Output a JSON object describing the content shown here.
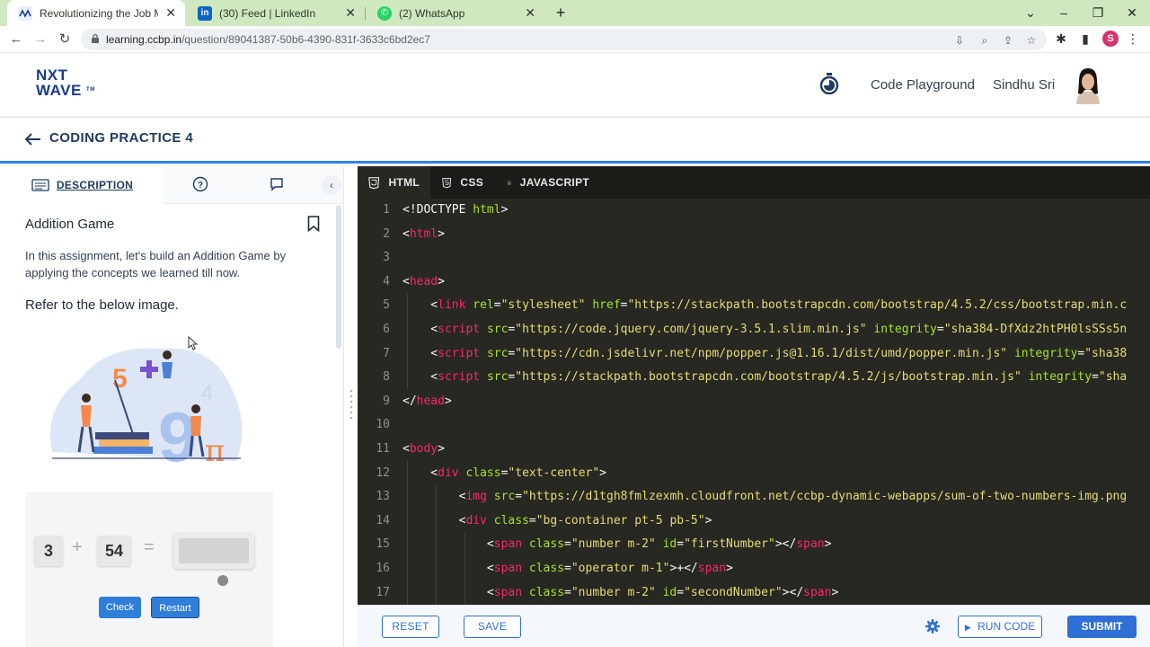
{
  "browser": {
    "tabs": [
      {
        "title": "Revolutionizing the Job Market |",
        "active": true
      },
      {
        "title": "(30) Feed | LinkedIn",
        "active": false
      },
      {
        "title": "(2) WhatsApp",
        "active": false
      }
    ],
    "url_host": "learning.ccbp.in",
    "url_path": "/question/89041387-50b6-4390-831f-3633c6bd2ec7",
    "profile_initial": "S"
  },
  "header": {
    "logo_line1": "NXT",
    "logo_line2": "WAVE",
    "logo_tm": "TM",
    "playground_label": "Code Playground",
    "user_name": "Sindhu Sri"
  },
  "practice": {
    "title": "CODING PRACTICE 4"
  },
  "left_panel": {
    "tab_description": "DESCRIPTION",
    "question_title": "Addition Game",
    "question_desc": "In this assignment, let's build an Addition Game by applying the concepts we learned till now.",
    "refer_text": "Refer to the below image.",
    "game": {
      "first_number": "3",
      "operator": "+",
      "second_number": "54",
      "equals": "=",
      "check_label": "Check",
      "restart_label": "Restart"
    },
    "illustration_digits": [
      "5",
      "9",
      "4",
      "π"
    ]
  },
  "editor": {
    "tabs": [
      "HTML",
      "CSS",
      "JAVASCRIPT"
    ],
    "lines": [
      {
        "n": "1",
        "parts": [
          [
            "txt",
            "<!DOCTYPE "
          ],
          [
            "attr",
            "html"
          ],
          [
            "txt",
            ">"
          ]
        ]
      },
      {
        "n": "2",
        "parts": [
          [
            "txt",
            "<"
          ],
          [
            "tag",
            "html"
          ],
          [
            "txt",
            ">"
          ]
        ]
      },
      {
        "n": "3",
        "parts": []
      },
      {
        "n": "4",
        "parts": [
          [
            "txt",
            "<"
          ],
          [
            "tag",
            "head"
          ],
          [
            "txt",
            ">"
          ]
        ]
      },
      {
        "n": "5",
        "parts": [
          [
            "txt",
            "    <"
          ],
          [
            "tag",
            "link"
          ],
          [
            "txt",
            " "
          ],
          [
            "attr",
            "rel"
          ],
          [
            "txt",
            "="
          ],
          [
            "str",
            "\"stylesheet\""
          ],
          [
            "txt",
            " "
          ],
          [
            "attr",
            "href"
          ],
          [
            "txt",
            "="
          ],
          [
            "str",
            "\"https://stackpath.bootstrapcdn.com/bootstrap/4.5.2/css/bootstrap.min.c"
          ]
        ]
      },
      {
        "n": "6",
        "parts": [
          [
            "txt",
            "    <"
          ],
          [
            "tag",
            "script"
          ],
          [
            "txt",
            " "
          ],
          [
            "attr",
            "src"
          ],
          [
            "txt",
            "="
          ],
          [
            "str",
            "\"https://code.jquery.com/jquery-3.5.1.slim.min.js\""
          ],
          [
            "txt",
            " "
          ],
          [
            "attr",
            "integrity"
          ],
          [
            "txt",
            "="
          ],
          [
            "str",
            "\"sha384-DfXdz2htPH0lsSSs5n"
          ]
        ]
      },
      {
        "n": "7",
        "parts": [
          [
            "txt",
            "    <"
          ],
          [
            "tag",
            "script"
          ],
          [
            "txt",
            " "
          ],
          [
            "attr",
            "src"
          ],
          [
            "txt",
            "="
          ],
          [
            "str",
            "\"https://cdn.jsdelivr.net/npm/popper.js@1.16.1/dist/umd/popper.min.js\""
          ],
          [
            "txt",
            " "
          ],
          [
            "attr",
            "integrity"
          ],
          [
            "txt",
            "="
          ],
          [
            "str",
            "\"sha38"
          ]
        ]
      },
      {
        "n": "8",
        "parts": [
          [
            "txt",
            "    <"
          ],
          [
            "tag",
            "script"
          ],
          [
            "txt",
            " "
          ],
          [
            "attr",
            "src"
          ],
          [
            "txt",
            "="
          ],
          [
            "str",
            "\"https://stackpath.bootstrapcdn.com/bootstrap/4.5.2/js/bootstrap.min.js\""
          ],
          [
            "txt",
            " "
          ],
          [
            "attr",
            "integrity"
          ],
          [
            "txt",
            "="
          ],
          [
            "str",
            "\"sha"
          ]
        ]
      },
      {
        "n": "9",
        "parts": [
          [
            "txt",
            "</"
          ],
          [
            "tag",
            "head"
          ],
          [
            "txt",
            ">"
          ]
        ]
      },
      {
        "n": "10",
        "parts": []
      },
      {
        "n": "11",
        "parts": [
          [
            "txt",
            "<"
          ],
          [
            "tag",
            "body"
          ],
          [
            "txt",
            ">"
          ]
        ]
      },
      {
        "n": "12",
        "parts": [
          [
            "txt",
            "    <"
          ],
          [
            "tag",
            "div"
          ],
          [
            "txt",
            " "
          ],
          [
            "attr",
            "class"
          ],
          [
            "txt",
            "="
          ],
          [
            "str",
            "\"text-center\""
          ],
          [
            "txt",
            ">"
          ]
        ]
      },
      {
        "n": "13",
        "parts": [
          [
            "txt",
            "        <"
          ],
          [
            "tag",
            "img"
          ],
          [
            "txt",
            " "
          ],
          [
            "attr",
            "src"
          ],
          [
            "txt",
            "="
          ],
          [
            "str",
            "\"https://d1tgh8fmlzexmh.cloudfront.net/ccbp-dynamic-webapps/sum-of-two-numbers-img.png"
          ]
        ]
      },
      {
        "n": "14",
        "parts": [
          [
            "txt",
            "        <"
          ],
          [
            "tag",
            "div"
          ],
          [
            "txt",
            " "
          ],
          [
            "attr",
            "class"
          ],
          [
            "txt",
            "="
          ],
          [
            "str",
            "\"bg-container pt-5 pb-5\""
          ],
          [
            "txt",
            ">"
          ]
        ]
      },
      {
        "n": "15",
        "parts": [
          [
            "txt",
            "            <"
          ],
          [
            "tag",
            "span"
          ],
          [
            "txt",
            " "
          ],
          [
            "attr",
            "class"
          ],
          [
            "txt",
            "="
          ],
          [
            "str",
            "\"number m-2\""
          ],
          [
            "txt",
            " "
          ],
          [
            "attr",
            "id"
          ],
          [
            "txt",
            "="
          ],
          [
            "str",
            "\"firstNumber\""
          ],
          [
            "txt",
            "></"
          ],
          [
            "tag",
            "span"
          ],
          [
            "txt",
            ">"
          ]
        ]
      },
      {
        "n": "16",
        "parts": [
          [
            "txt",
            "            <"
          ],
          [
            "tag",
            "span"
          ],
          [
            "txt",
            " "
          ],
          [
            "attr",
            "class"
          ],
          [
            "txt",
            "="
          ],
          [
            "str",
            "\"operator m-1\""
          ],
          [
            "txt",
            ">+</"
          ],
          [
            "tag",
            "span"
          ],
          [
            "txt",
            ">"
          ]
        ]
      },
      {
        "n": "17",
        "parts": [
          [
            "txt",
            "            <"
          ],
          [
            "tag",
            "span"
          ],
          [
            "txt",
            " "
          ],
          [
            "attr",
            "class"
          ],
          [
            "txt",
            "="
          ],
          [
            "str",
            "\"number m-2\""
          ],
          [
            "txt",
            " "
          ],
          [
            "attr",
            "id"
          ],
          [
            "txt",
            "="
          ],
          [
            "str",
            "\"secondNumber\""
          ],
          [
            "txt",
            "></"
          ],
          [
            "tag",
            "span"
          ],
          [
            "txt",
            ">"
          ]
        ]
      }
    ]
  },
  "actions": {
    "reset": "RESET",
    "save": "SAVE",
    "run": "RUN CODE",
    "submit": "SUBMIT"
  },
  "colors": {
    "accent": "#2f6fd6",
    "editor_bg": "#272822",
    "tabstrip_bg": "#cfe8c0"
  }
}
